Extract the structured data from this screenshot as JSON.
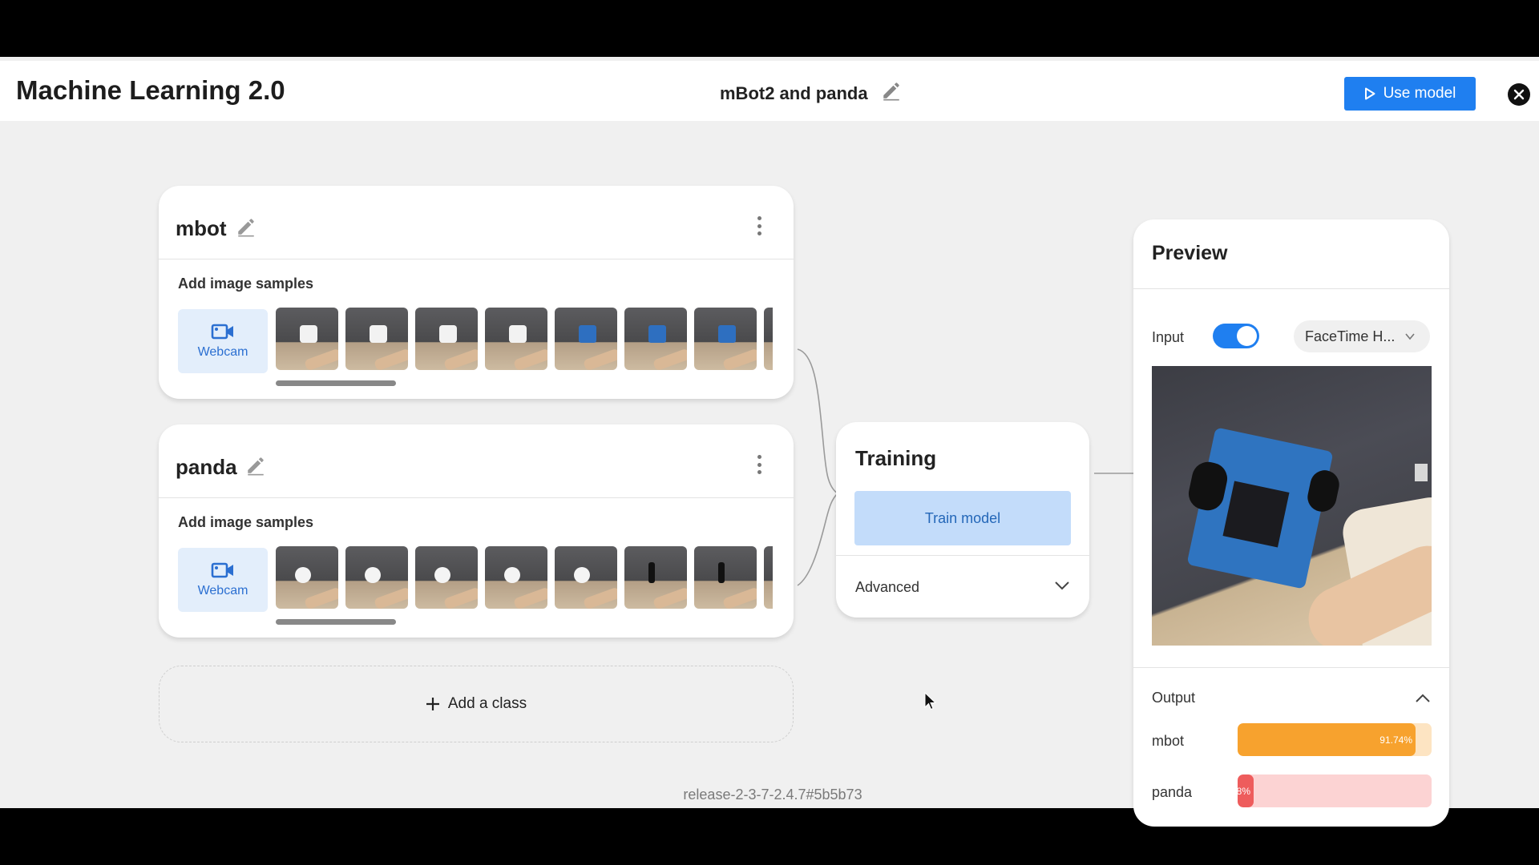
{
  "header": {
    "app_title": "Machine Learning 2.0",
    "project_name": "mBot2 and panda",
    "use_model_label": "Use model"
  },
  "classes": [
    {
      "name": "mbot",
      "samples_label": "Add image samples",
      "webcam_label": "Webcam"
    },
    {
      "name": "panda",
      "samples_label": "Add image samples",
      "webcam_label": "Webcam"
    }
  ],
  "add_class_label": "Add a class",
  "training": {
    "title": "Training",
    "train_button_label": "Train model",
    "advanced_label": "Advanced"
  },
  "preview": {
    "title": "Preview",
    "input_label": "Input",
    "input_enabled": true,
    "camera_select_value": "FaceTime H...",
    "output_label": "Output",
    "outputs": [
      {
        "label": "mbot",
        "percent_text": "91.74%",
        "value": 91.74,
        "color": "#f7a22e",
        "track_color": "#fde4c2"
      },
      {
        "label": "panda",
        "percent_text": "8%",
        "value": 8.26,
        "color": "#ee5c5c",
        "track_color": "#fcd3d3"
      }
    ]
  },
  "footer": {
    "version": "release-2-3-7-2.4.7#5b5b73"
  },
  "colors": {
    "accent": "#1f7ff0",
    "train_button_bg": "#c3dcfa",
    "webcam_bg": "#e3eefb"
  }
}
